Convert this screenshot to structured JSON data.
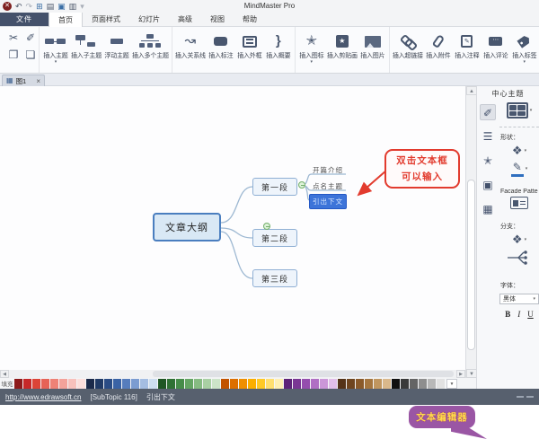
{
  "window": {
    "title": "MindMaster Pro"
  },
  "quick_access": {
    "icons": [
      {
        "name": "close",
        "glyph": "✕"
      },
      {
        "name": "undo",
        "glyph": "↶"
      },
      {
        "name": "redo",
        "glyph": "↷"
      },
      {
        "name": "import",
        "glyph": "⊞"
      },
      {
        "name": "capture",
        "glyph": "▤"
      },
      {
        "name": "save",
        "glyph": "▣"
      },
      {
        "name": "print",
        "glyph": "▥"
      },
      {
        "name": "more",
        "glyph": "▾"
      }
    ]
  },
  "menu": {
    "file": "文件",
    "tabs": [
      "首页",
      "页面样式",
      "幻灯片",
      "高级",
      "视图",
      "帮助"
    ],
    "active": "首页"
  },
  "ribbon": {
    "clipboard": {
      "cut": "✂",
      "format_brush": "✐",
      "copy": "❐",
      "paste": "❏"
    },
    "groups": [
      {
        "buttons": [
          {
            "label": "插入主题",
            "caret": "▾"
          },
          {
            "label": "插入子主题"
          },
          {
            "label": "浮动主题"
          },
          {
            "label": "插入多个主题"
          }
        ]
      },
      {
        "buttons": [
          {
            "label": "插入关系线",
            "glyph": "↝"
          },
          {
            "label": "插入标注"
          },
          {
            "label": "插入外框"
          },
          {
            "label": "插入概要",
            "glyph": "}"
          }
        ]
      },
      {
        "buttons": [
          {
            "label": "插入图标",
            "glyph": "✭",
            "caret": "▾"
          },
          {
            "label": "插入剪贴画"
          },
          {
            "label": "插入图片"
          }
        ]
      },
      {
        "buttons": [
          {
            "label": "插入超链接"
          },
          {
            "label": "插入附件"
          },
          {
            "label": "插入注释"
          },
          {
            "label": "插入评论"
          },
          {
            "label": "插入标签",
            "caret": "▾"
          }
        ]
      }
    ]
  },
  "document_tab": {
    "label": "图1",
    "close": "×"
  },
  "mindmap": {
    "root": "文章大纲",
    "branches": [
      {
        "label": "第一段"
      },
      {
        "label": "第二段"
      },
      {
        "label": "第三段"
      }
    ],
    "subtopics": [
      {
        "label": "开篇介绍"
      },
      {
        "label": "点名主题"
      },
      {
        "label": "引出下文",
        "selected": true
      }
    ]
  },
  "annotations": {
    "double_click_line1": "双击文本框",
    "double_click_line2": "可以输入",
    "text_editor": "文本编辑器"
  },
  "right_panel": {
    "header": "中心主题",
    "tool_icons": [
      {
        "name": "theme-brush",
        "glyph": "✐"
      },
      {
        "name": "outline",
        "glyph": "☰"
      },
      {
        "name": "icon-mark",
        "glyph": "✭"
      },
      {
        "name": "clipart",
        "glyph": "▣"
      },
      {
        "name": "task",
        "glyph": "▦"
      }
    ],
    "shape_label": "形状：",
    "shape_glyph": "❖",
    "pencil_glyph": "✎",
    "facade_label": "Facade Patte",
    "branch_label": "分支：",
    "branch_glyph": "❖",
    "font_label": "字体：",
    "font_value": "黑体",
    "dropdown_caret": "▾",
    "bold": "B",
    "italic": "I",
    "underline": "U"
  },
  "palette": {
    "label": "填充",
    "colors": [
      "#8d1a1a",
      "#c62828",
      "#dc4437",
      "#e66357",
      "#ee8276",
      "#f4a29a",
      "#f8c1bc",
      "#fcdfdc",
      "#1b2a4a",
      "#203a66",
      "#2a4c85",
      "#3a63a5",
      "#567dbd",
      "#7b9cd1",
      "#a4bde2",
      "#cddef0",
      "#1f5624",
      "#2f7134",
      "#468c49",
      "#64a563",
      "#86bb82",
      "#a9d0a3",
      "#cce4c8",
      "#c25200",
      "#dd6f00",
      "#ef8f00",
      "#fbae00",
      "#ffc926",
      "#ffdf70",
      "#fff0b3",
      "#5e2378",
      "#7a3694",
      "#954eae",
      "#b06fc4",
      "#cb96d8",
      "#e2bfe9",
      "#553318",
      "#6f451f",
      "#8a5a2a",
      "#a5763f",
      "#c0965f",
      "#d9b88b",
      "#111111",
      "#3a3a3a",
      "#646464",
      "#8e8e8e",
      "#b8b8b8",
      "#e2e2e2"
    ]
  },
  "status_bar": {
    "url": "http://www.edrawsoft.cn",
    "topic_ref": "[SubTopic 116]",
    "topic_text": "引出下文"
  },
  "accent_colors": {
    "selection_blue": "#3d74d9",
    "annotation_red": "#e23b2e",
    "callout_purple": "#9a56a4",
    "node_border_blue": "#4a7ebf"
  }
}
